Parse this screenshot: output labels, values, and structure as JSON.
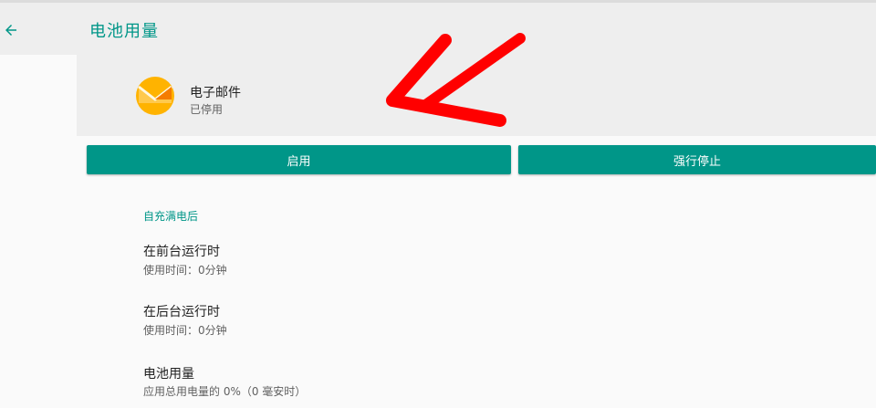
{
  "header": {
    "title": "电池用量"
  },
  "app": {
    "name": "电子邮件",
    "status": "已停用",
    "icon": "email-app-icon"
  },
  "buttons": {
    "enable": "启用",
    "force_stop": "强行停止"
  },
  "section": {
    "title": "自充满电后"
  },
  "prefs": [
    {
      "title": "在前台运行时",
      "summary": "使用时间：0分钟"
    },
    {
      "title": "在后台运行时",
      "summary": "使用时间：0分钟"
    },
    {
      "title": "电池用量",
      "summary": "应用总用电量的 0%（0 毫安时）"
    }
  ],
  "colors": {
    "accent": "#009688",
    "annotation": "#ff0000"
  }
}
